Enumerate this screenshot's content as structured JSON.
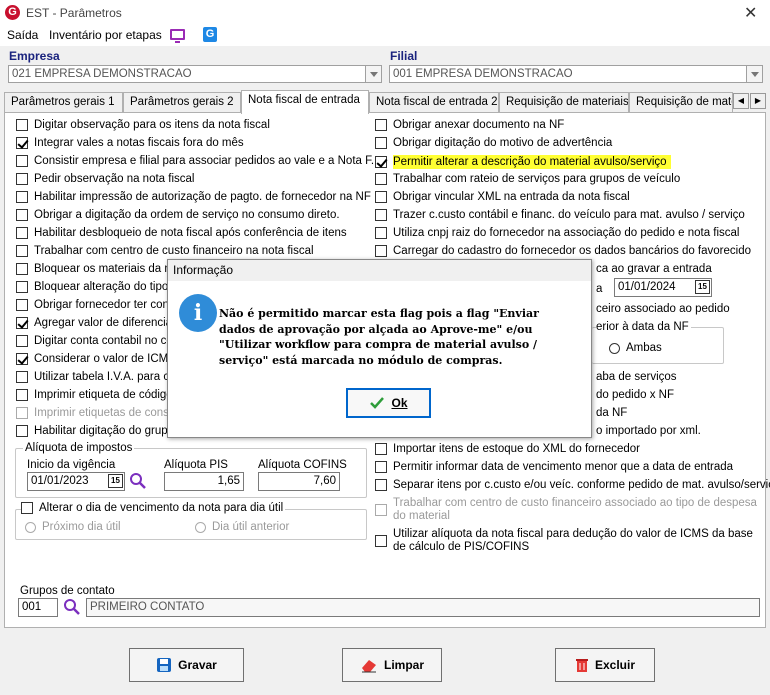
{
  "window": {
    "title": "EST - Parâmetros",
    "logo": "G"
  },
  "menu": {
    "saida": "Saída",
    "inventario": "Inventário por etapas",
    "g_logo": "G"
  },
  "empresa": {
    "label": "Empresa",
    "value": "021 EMPRESA DEMONSTRACAO"
  },
  "filial": {
    "label": "Filial",
    "value": "001 EMPRESA DEMONSTRACAO"
  },
  "tabs": [
    {
      "label": "Parâmetros gerais 1",
      "active": false
    },
    {
      "label": "Parâmetros gerais 2",
      "active": false
    },
    {
      "label": "Nota fiscal de entrada",
      "active": true
    },
    {
      "label": "Nota fiscal de entrada 2",
      "active": false
    },
    {
      "label": "Requisição de materiais",
      "active": false
    },
    {
      "label": "Requisição de materiais",
      "active": false
    }
  ],
  "left_checks": [
    {
      "label": "Digitar observação para os itens da nota fiscal",
      "checked": false
    },
    {
      "label": "Integrar vales a notas fiscais fora do mês",
      "checked": true
    },
    {
      "label": "Consistir empresa e filial para associar pedidos ao vale e a Nota F.",
      "checked": false
    },
    {
      "label": "Pedir observação na nota fiscal",
      "checked": false
    },
    {
      "label": "Habilitar impressão de autorização de pagto. de fornecedor na NF",
      "checked": false
    },
    {
      "label": "Obrigar a digitação da ordem de serviço no consumo direto.",
      "checked": false
    },
    {
      "label": "Habilitar desbloqueio de nota fiscal após conferência de itens",
      "checked": false
    },
    {
      "label": "Trabalhar com centro de custo financeiro na nota fiscal",
      "checked": false
    },
    {
      "label": "Bloquear os materiais da nota",
      "checked": false
    },
    {
      "label": "Bloquear alteração do tipo de",
      "checked": false
    },
    {
      "label": "Obrigar fornecedor ter contra",
      "checked": false
    },
    {
      "label": "Agregar valor de diferencial d",
      "checked": true
    },
    {
      "label": "Digitar conta contabil no centr",
      "checked": false
    },
    {
      "label": "Considerar o valor de ICMS d",
      "checked": true
    },
    {
      "label": "Utilizar tabela I.V.A. para calc",
      "checked": false
    },
    {
      "label": "Imprimir etiqueta de código d",
      "checked": false
    },
    {
      "label": "Imprimir etiquetas de consum",
      "checked": false,
      "disabled": true
    },
    {
      "label": "Habilitar digitação do grupo d",
      "checked": false
    }
  ],
  "right_checks_top": [
    {
      "label": "Obrigar anexar documento na NF",
      "checked": false
    },
    {
      "label": "Obrigar digitação do motivo de advertência",
      "checked": false
    },
    {
      "label": "Permitir alterar a descrição do material avulso/serviço",
      "checked": true,
      "highlight": true
    },
    {
      "label": "Trabalhar com rateio de serviços para grupos de veículo",
      "checked": false
    },
    {
      "label": "Obrigar vincular XML na entrada da nota fiscal",
      "checked": false
    },
    {
      "label": "Trazer c.custo contábil e financ. do veículo para mat. avulso / serviço",
      "checked": false
    },
    {
      "label": "Utiliza cnpj raiz do fornecedor na associação do pedido e nota fiscal",
      "checked": false
    },
    {
      "label": "Carregar do cadastro do fornecedor os dados bancários do favorecido",
      "checked": false
    }
  ],
  "right_partials": {
    "p1": "ca ao gravar a entrada",
    "p2": "a",
    "date": "01/01/2024",
    "p3": "ceiro associado ao pedido",
    "p4": "erior à data da NF",
    "ambas": "Ambas",
    "p5": "aba de serviços",
    "p6": "do pedido x NF",
    "p7": "da NF",
    "p8": "o importado por xml."
  },
  "right_checks_bottom": [
    {
      "label": "Importar itens de estoque do XML do fornecedor",
      "checked": false
    },
    {
      "label": "Permitir informar data de vencimento menor que a data de entrada",
      "checked": false
    },
    {
      "label": "Separar itens por c.custo e/ou veíc. conforme pedido de mat. avulso/serviço",
      "checked": false
    },
    {
      "label": "Trabalhar com centro de custo financeiro associado ao tipo de despesa do material",
      "checked": false,
      "disabled": true
    },
    {
      "label": "Utilizar alíquota da nota fiscal para dedução do valor de ICMS da base de cálculo de PIS/COFINS",
      "checked": false
    }
  ],
  "impostos": {
    "title": "Alíquota de impostos",
    "vigencia_label": "Inicio da vigência",
    "vigencia_value": "01/01/2023",
    "pis_label": "Alíquota PIS",
    "pis_value": "1,65",
    "cofins_label": "Alíquota COFINS",
    "cofins_value": "7,60"
  },
  "vencimento": {
    "label": "Alterar o dia de vencimento da nota para dia útil",
    "checked": false,
    "opt1": "Próximo dia útil",
    "opt2": "Dia útil anterior"
  },
  "contato": {
    "label": "Grupos de contato",
    "code": "001",
    "name": "PRIMEIRO CONTATO"
  },
  "buttons": {
    "gravar": "Gravar",
    "limpar": "Limpar",
    "excluir": "Excluir"
  },
  "calendar_glyph": "15",
  "modal": {
    "title": "Informação",
    "icon": "i",
    "message": "Não é permitido marcar esta flag pois a flag \"Enviar dados de aprovação por alçada ao Aprove-me\" e/ou \"Utilizar workflow para compra de material avulso / serviço\" está marcada no módulo de compras.",
    "ok": "Ok"
  },
  "colors": {
    "highlight": "#ffff33",
    "title_blue": "#1a237e",
    "info_blue": "#2f8cd8",
    "ok_border": "#0066cc"
  }
}
